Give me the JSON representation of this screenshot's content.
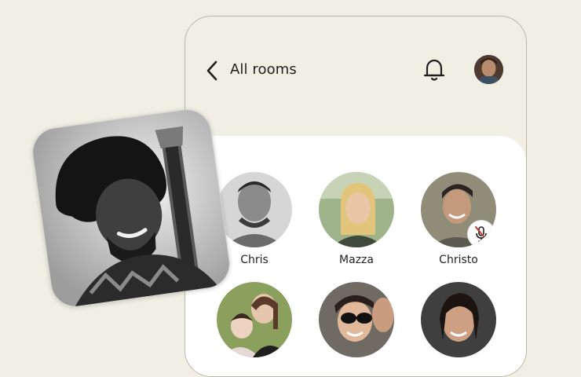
{
  "header": {
    "title": "All rooms",
    "icons": {
      "back": "chevron-left-icon",
      "notifications": "bell-icon",
      "profile": "avatar"
    }
  },
  "participants": [
    {
      "name": "Chris",
      "photo": "grayscale portrait"
    },
    {
      "name": "Mazza",
      "photo": "outdoor portrait"
    },
    {
      "name": "Christo",
      "photo": "smiling portrait",
      "muted": true
    },
    {
      "name": "",
      "photo": "woman with child"
    },
    {
      "name": "",
      "photo": "woman with sunglasses"
    },
    {
      "name": "",
      "photo": "smiling woman"
    }
  ],
  "colors": {
    "background": "#f1efe4",
    "card": "#ffffff",
    "text": "#1f1f1f",
    "mute_red": "#c0392b"
  }
}
